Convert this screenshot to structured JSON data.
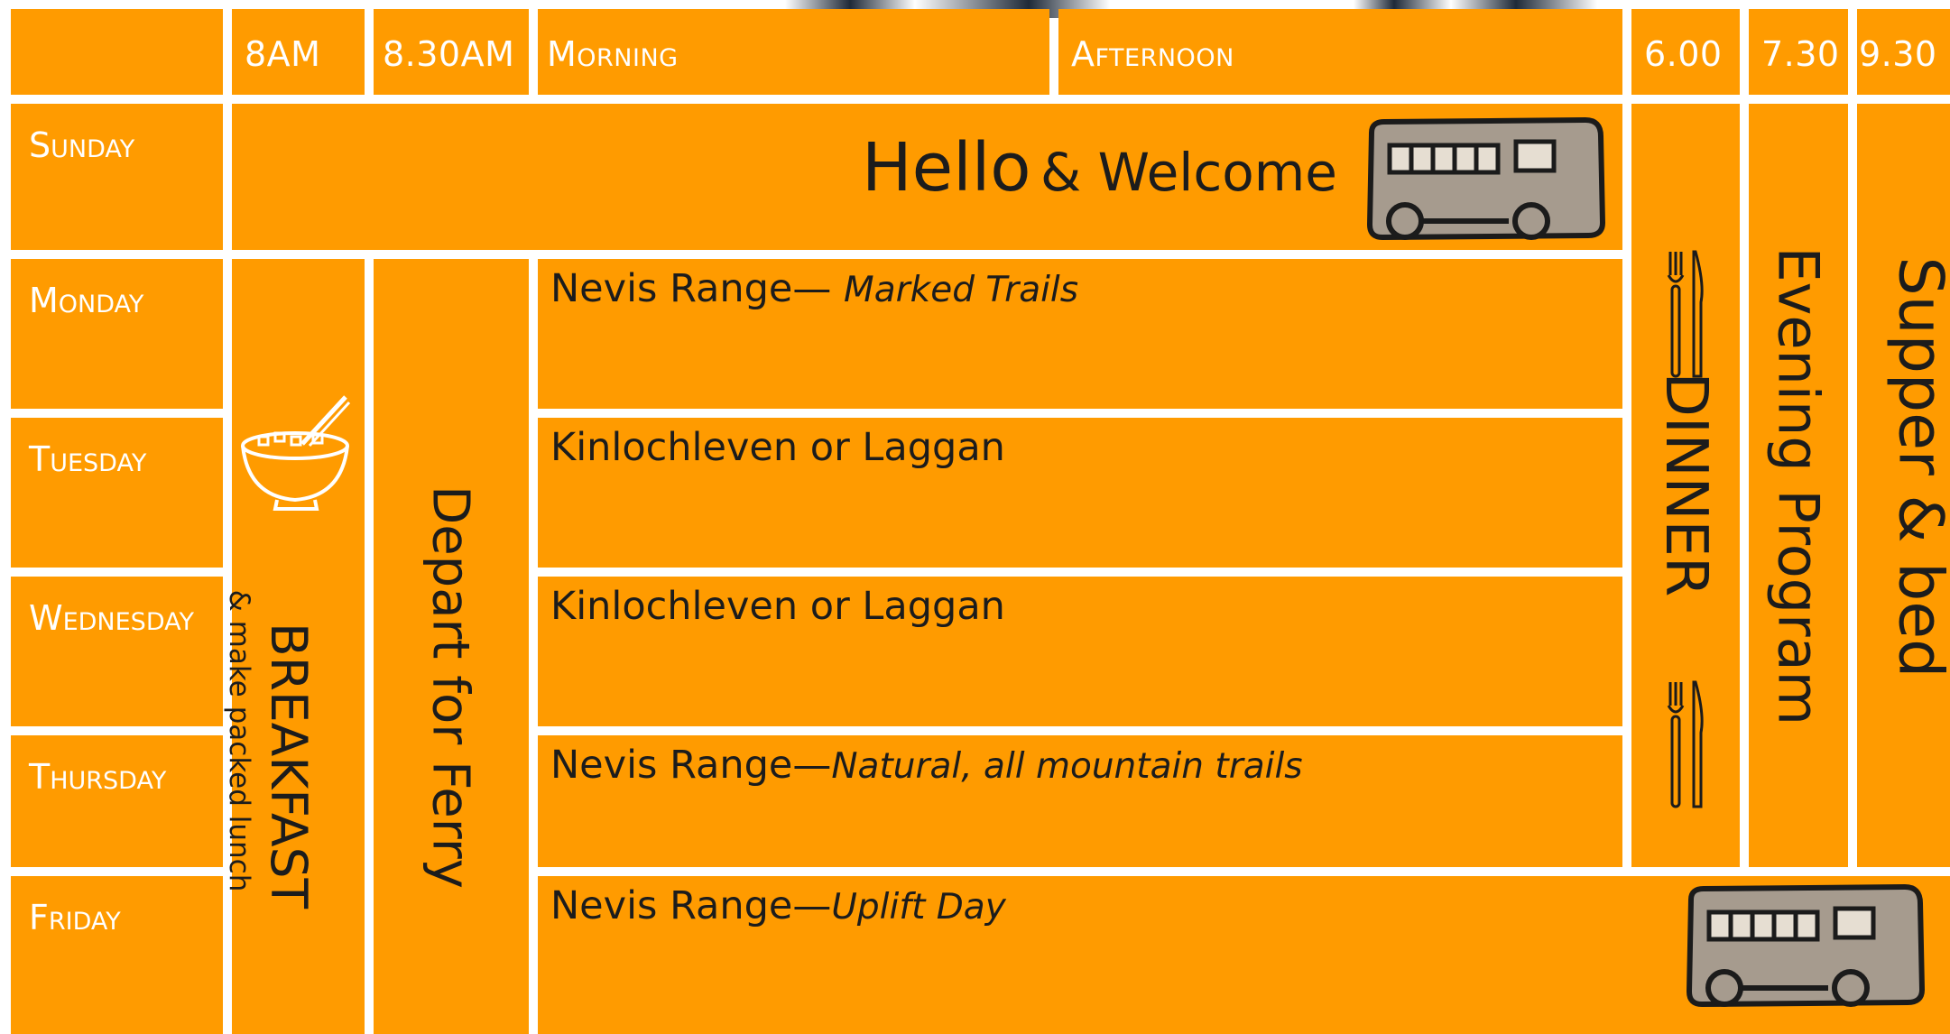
{
  "header": {
    "cols": [
      "8AM",
      "8.30AM",
      "Morning",
      "Afternoon",
      "6.00",
      "7.30",
      "9.30"
    ]
  },
  "days": [
    "Sunday",
    "Monday",
    "Tuesday",
    "Wednesday",
    "Thursday",
    "Friday"
  ],
  "sunday": {
    "hello": "Hello",
    "welcome": "& Welcome",
    "bus_icon": "bus-icon"
  },
  "breakfast": {
    "title": "BREAKFAST",
    "subtitle": "& make packed lunch",
    "icon": "cereal-bowl-icon"
  },
  "ferry": {
    "label": "Depart for Ferry"
  },
  "activities": [
    {
      "place": "Nevis Range—",
      "detail": "Marked Trails"
    },
    {
      "place": "Kinlochleven or Laggan",
      "detail": ""
    },
    {
      "place": "Kinlochleven or Laggan",
      "detail": ""
    },
    {
      "place": "Nevis Range—",
      "detail": "Natural, all mountain trails"
    },
    {
      "place": "Nevis Range—",
      "detail": "Uplift Day"
    }
  ],
  "dinner": {
    "label": "DINNER",
    "icon": "cutlery-icon"
  },
  "evening": {
    "label": "Evening Program"
  },
  "supper": {
    "label": "Supper & bed"
  },
  "colors": {
    "cell": "#ff9b00",
    "grid": "#ffffff",
    "bus": "#a69b8e"
  }
}
